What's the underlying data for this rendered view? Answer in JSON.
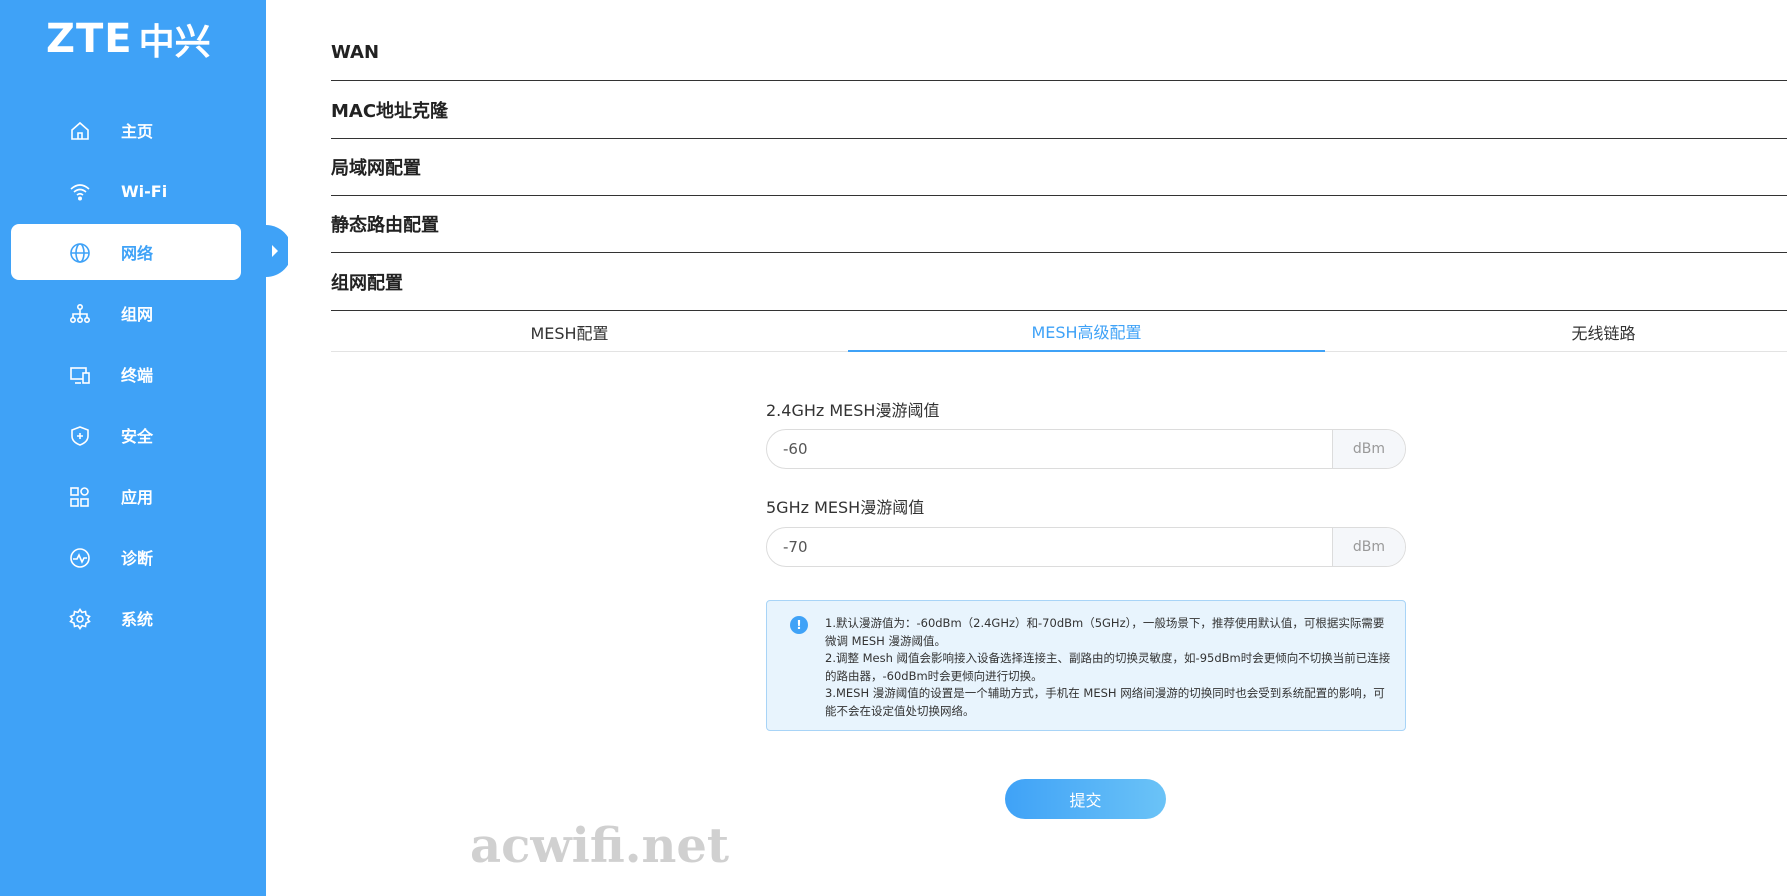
{
  "brand": {
    "logo_text": "ZTE",
    "logo_cn": "中兴"
  },
  "sidebar": {
    "items": [
      {
        "label": "主页",
        "icon": "home-icon"
      },
      {
        "label": "Wi-Fi",
        "icon": "wifi-icon"
      },
      {
        "label": "网络",
        "icon": "globe-icon",
        "active": true
      },
      {
        "label": "组网",
        "icon": "network-tree-icon"
      },
      {
        "label": "终端",
        "icon": "devices-icon"
      },
      {
        "label": "安全",
        "icon": "shield-icon"
      },
      {
        "label": "应用",
        "icon": "apps-icon"
      },
      {
        "label": "诊断",
        "icon": "diagnostics-icon"
      },
      {
        "label": "系统",
        "icon": "gear-icon"
      }
    ]
  },
  "sections": [
    {
      "title": "WAN"
    },
    {
      "title": "MAC地址克隆"
    },
    {
      "title": "局域网配置"
    },
    {
      "title": "静态路由配置"
    },
    {
      "title": "组网配置"
    }
  ],
  "tabs": [
    {
      "label": "MESH配置"
    },
    {
      "label": "MESH高级配置",
      "active": true
    },
    {
      "label": "无线链路"
    }
  ],
  "form": {
    "field_24": {
      "label": "2.4GHz MESH漫游阈值",
      "value": "-60",
      "unit": "dBm"
    },
    "field_5": {
      "label": "5GHz MESH漫游阈值",
      "value": "-70",
      "unit": "dBm"
    }
  },
  "notice": {
    "icon": "info-icon",
    "line1": "1.默认漫游值为：-60dBm（2.4GHz）和-70dBm（5GHz），一般场景下，推荐使用默认值，可根据实际需要微调 MESH 漫游阈值。",
    "line2": "2.调整 Mesh 阈值会影响接入设备选择连接主、副路由的切换灵敏度，如-95dBm时会更倾向不切换当前已连接的路由器，-60dBm时会更倾向进行切换。",
    "line3": "3.MESH 漫游阈值的设置是一个辅助方式，手机在 MESH 网络间漫游的切换同时也会受到系统配置的影响，可能不会在设定值处切换网络。"
  },
  "submit_label": "提交",
  "watermark": "acwifi.net",
  "colors": {
    "accent": "#3fa2f7",
    "notice_bg": "#e8f4fd"
  }
}
